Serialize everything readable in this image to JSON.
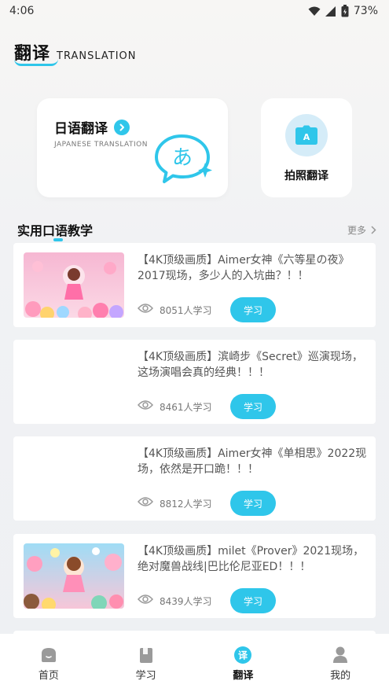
{
  "status": {
    "time": "4:06",
    "battery": "73%"
  },
  "header": {
    "title": "翻译",
    "subtitle": "TRANSLATION"
  },
  "cards": {
    "japanese": {
      "title": "日语翻译",
      "subtitle": "JAPANESE TRANSLATION",
      "icon_glyph": "あ"
    },
    "photo": {
      "label": "拍照翻译"
    }
  },
  "section": {
    "title": "实用口语教学",
    "more": "更多"
  },
  "items": [
    {
      "title": "【4K顶级画质】Aimer女神《六等星の夜》2017现场，多少人的入坑曲？！！",
      "views": "8051人学习",
      "button": "学习",
      "has_image": true
    },
    {
      "title": "【4K顶级画质】滨崎步《Secret》巡演现场，这场演唱会真的经典！！！",
      "views": "8461人学习",
      "button": "学习",
      "has_image": false
    },
    {
      "title": "【4K顶级画质】Aimer女神《单相思》2022现场，依然是开口跪！！！",
      "views": "8812人学习",
      "button": "学习",
      "has_image": false
    },
    {
      "title": "【4K顶级画质】milet《Prover》2021现场，绝对魔兽战线|巴比伦尼亚ED！！！",
      "views": "8439人学习",
      "button": "学习",
      "has_image": true
    }
  ],
  "nav": {
    "home": "首页",
    "study": "学习",
    "translate": "翻译",
    "translate_badge": "译",
    "mine": "我的"
  },
  "colors": {
    "accent": "#2fc6ea",
    "icon_bg": "#d5ecf8"
  }
}
